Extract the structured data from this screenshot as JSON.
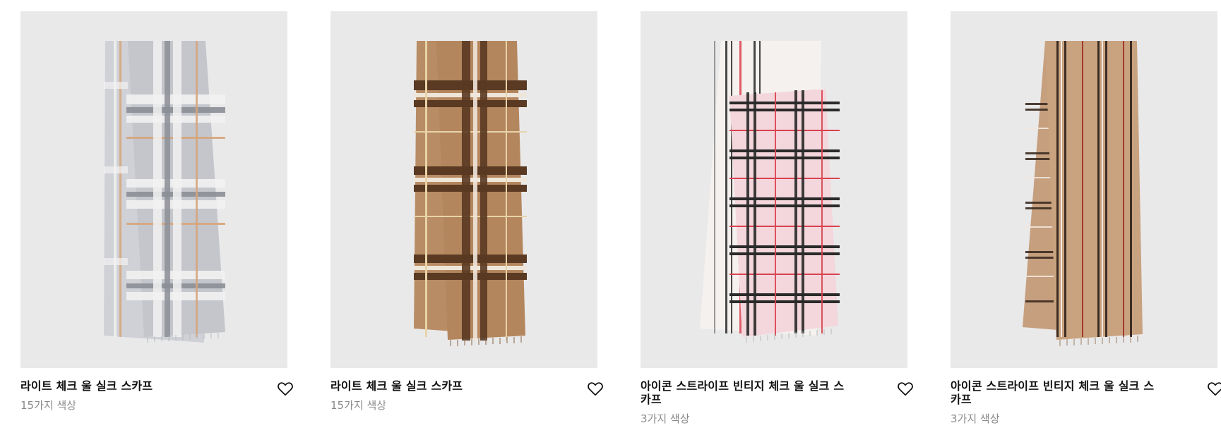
{
  "products": [
    {
      "name": "라이트 체크 울 실크 스카프",
      "colors_text": "15가지 색상",
      "image_icon": "scarf-grey-check-image",
      "palette": {
        "base": "#c4c6cc",
        "stripe_dark": "#8d8f96",
        "stripe_light": "#f2f2f2",
        "accent": "#d7a57a"
      }
    },
    {
      "name": "라이트 체크 울 실크 스카프",
      "colors_text": "15가지 색상",
      "image_icon": "scarf-camel-check-image",
      "palette": {
        "base": "#b4865e",
        "stripe_dark": "#5a3a22",
        "stripe_light": "#efe6da",
        "accent": "#8f5f39"
      }
    },
    {
      "name": "아이콘 스트라이프 빈티지 체크 울 실크 스카프",
      "colors_text": "3가지 색상",
      "image_icon": "scarf-pink-check-image",
      "palette": {
        "base": "#f3d7dc",
        "stripe_dark": "#2a2a2a",
        "stripe_light": "#fafafa",
        "accent": "#d9424f"
      }
    },
    {
      "name": "아이콘 스트라이프 빈티지 체크 울 실크 스카프",
      "colors_text": "3가지 색상",
      "image_icon": "scarf-beige-stripe-image",
      "palette": {
        "base": "#c9a27f",
        "stripe_dark": "#3d2c22",
        "stripe_light": "#f1e7dc",
        "accent": "#a23a2e"
      }
    }
  ],
  "favorite_icon": "heart-outline-icon"
}
